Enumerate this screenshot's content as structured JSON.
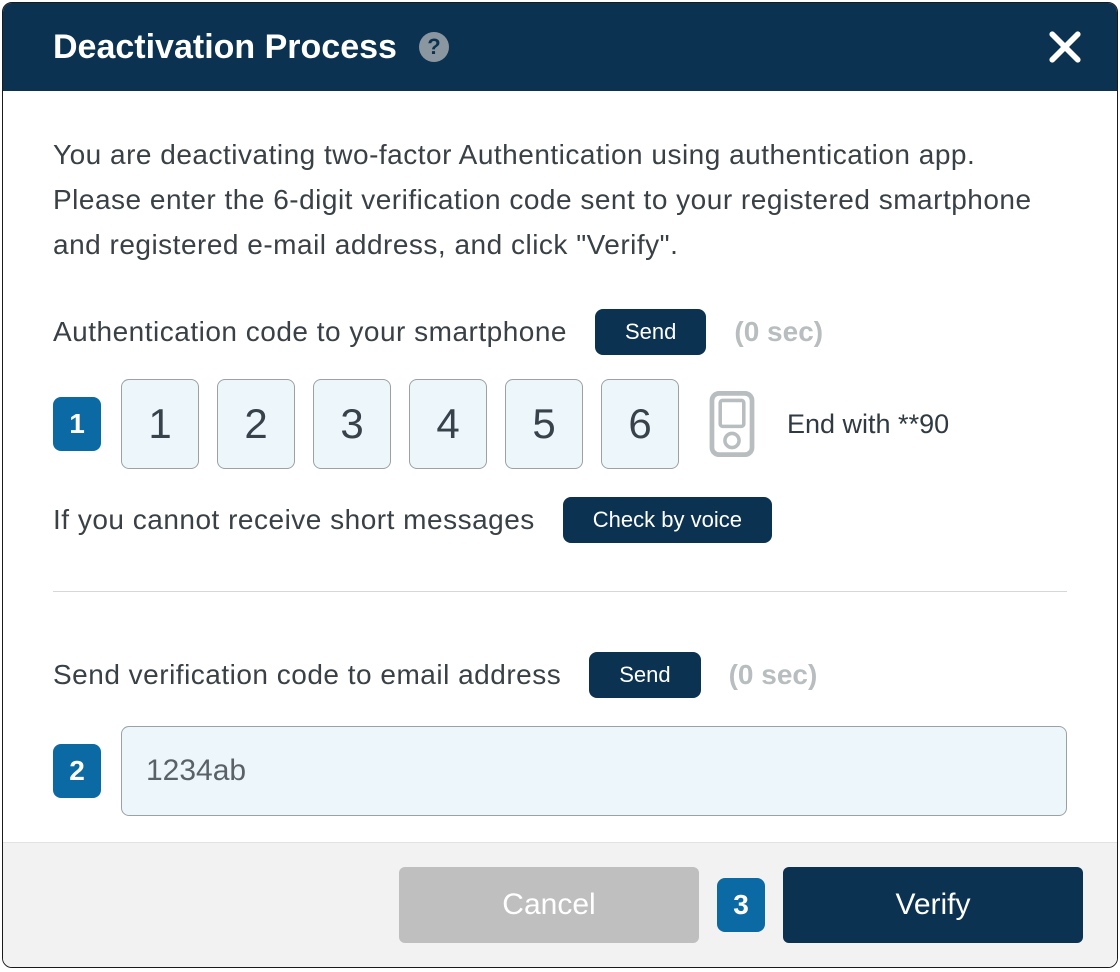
{
  "header": {
    "title": "Deactivation Process",
    "help_symbol": "?"
  },
  "intro": "You are deactivating two-factor Authentication using authentication app. Please enter the 6-digit verification code sent to your registered smartphone and registered e-mail address, and click \"Verify\".",
  "phone": {
    "label": "Authentication code to your smartphone",
    "send_label": "Send",
    "timer": "(0 sec)",
    "step": "1",
    "digits": [
      "1",
      "2",
      "3",
      "4",
      "5",
      "6"
    ],
    "end_with": "End with **90",
    "voice_hint": "If you cannot receive short messages",
    "voice_button": "Check by voice"
  },
  "email": {
    "label": "Send verification code to email address",
    "send_label": "Send",
    "timer": "(0 sec)",
    "step": "2",
    "value": "1234ab"
  },
  "footer": {
    "cancel": "Cancel",
    "verify": "Verify",
    "verify_step": "3"
  }
}
